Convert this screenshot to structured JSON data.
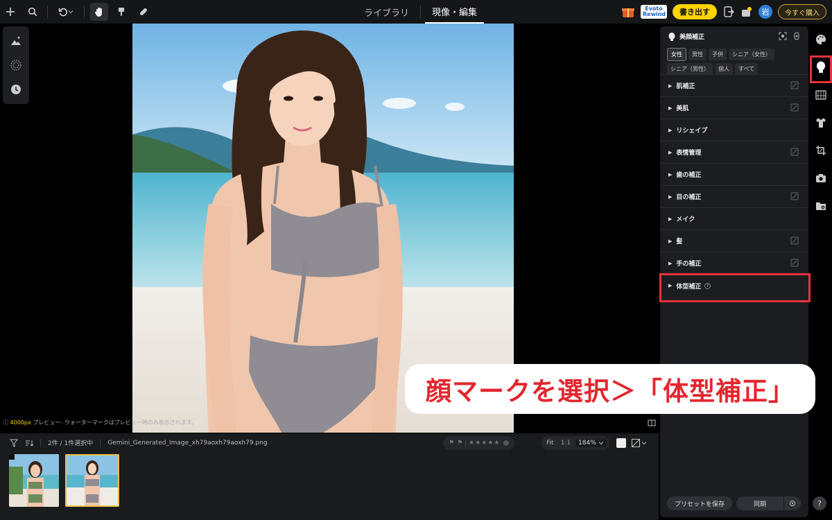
{
  "topbar": {
    "tabs": [
      {
        "label": "ライブラリ"
      },
      {
        "label": "現像・編集"
      }
    ],
    "export_label": "書き出す",
    "rewind_badge": "Evoto Rewind",
    "avatar_initial": "岩",
    "buy_label": "今すぐ購入"
  },
  "preview_note": {
    "size": "4000px",
    "text": " プレビュー- ウォーターマークはプレビュー時のみ表示されます。"
  },
  "filmstrip": {
    "selection_count": "2件 / 1件選択中",
    "filename": "Gemini_Generated_Image_xh79aoxh79aoxh79.png",
    "stars": "★★★★★",
    "fit_label": "Fit",
    "one_to_one_label": "1:1",
    "zoom": "184%"
  },
  "panel": {
    "title": "美顔補正",
    "chips": [
      "女性",
      "男性",
      "子供",
      "シニア（女性）",
      "シニア（男性）",
      "個人",
      "すべて"
    ],
    "selected_chip": "女性",
    "sections": [
      {
        "label": "肌補正"
      },
      {
        "label": "美肌"
      },
      {
        "label": "リシェイプ"
      },
      {
        "label": "表情管理"
      },
      {
        "label": "歯の補正"
      },
      {
        "label": "目の補正"
      },
      {
        "label": "メイク"
      },
      {
        "label": "髪"
      },
      {
        "label": "手の補正"
      },
      {
        "label": "体型補正"
      }
    ],
    "save_preset_label": "プリセットを保存",
    "sync_label": "同期"
  },
  "annotation": {
    "callout_text": "顔マークを選択＞「体型補正」",
    "highlight_color": "#e8323c"
  },
  "help_label": "?"
}
